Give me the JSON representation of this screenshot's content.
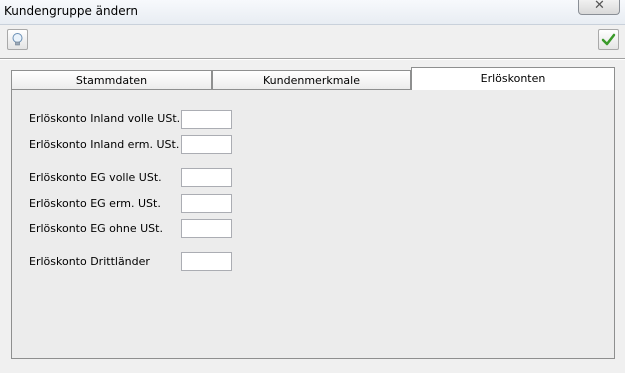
{
  "window": {
    "title": "Kundengruppe ändern",
    "close_icon": "close-icon"
  },
  "toolbar": {
    "info_icon": "lightbulb-icon",
    "confirm_icon": "checkmark-icon"
  },
  "tabs": [
    {
      "label": "Stammdaten",
      "active": false
    },
    {
      "label": "Kundenmerkmale",
      "active": false
    },
    {
      "label": "Erlöskonten",
      "active": true
    }
  ],
  "form": {
    "fields": [
      {
        "label": "Erlöskonto Inland volle USt.",
        "value": ""
      },
      {
        "label": "Erlöskonto Inland erm. USt.",
        "value": ""
      },
      {
        "label": "Erlöskonto EG volle USt.",
        "value": ""
      },
      {
        "label": "Erlöskonto EG erm. USt.",
        "value": ""
      },
      {
        "label": "Erlöskonto EG ohne USt.",
        "value": ""
      },
      {
        "label": "Erlöskonto Drittländer",
        "value": ""
      }
    ]
  },
  "colors": {
    "accent_check": "#3a9a2a",
    "panel_bg": "#ececec"
  }
}
